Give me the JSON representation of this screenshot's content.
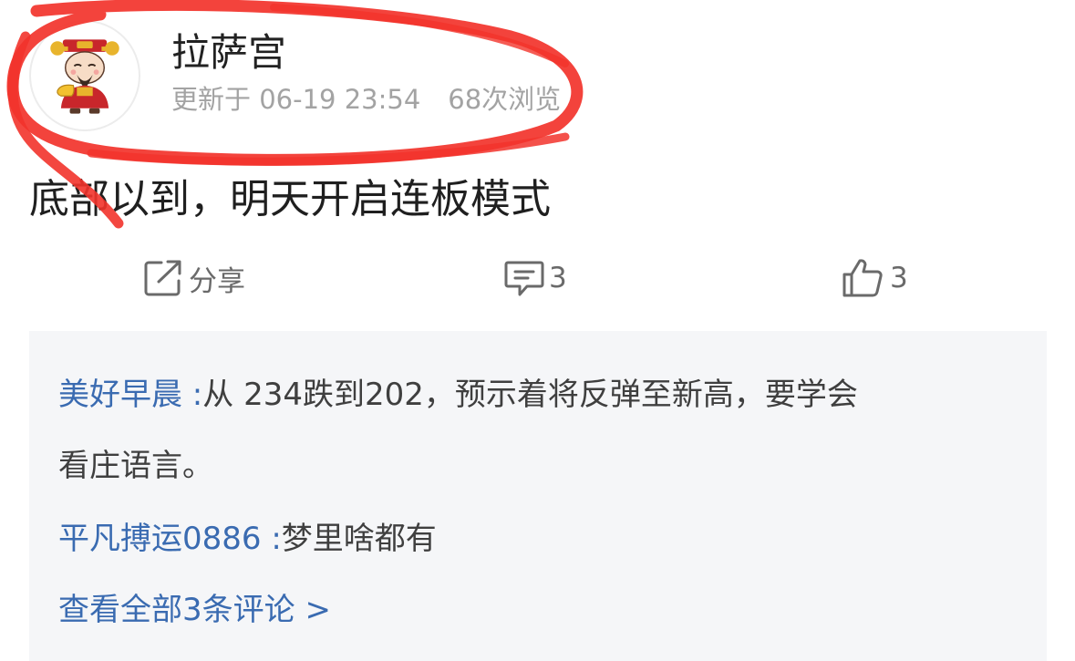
{
  "author": {
    "name": "拉萨宫",
    "avatar_icon": "god-of-wealth-avatar-icon"
  },
  "meta": {
    "updated": "更新于 06-19 23:54",
    "views": "68次浏览"
  },
  "post": {
    "text": "底部以到，明天开启连板模式"
  },
  "actions": {
    "share_label": "分享",
    "share_icon": "share-icon",
    "comment_count": "3",
    "comment_icon": "comment-icon",
    "like_count": "3",
    "like_icon": "thumbs-up-icon"
  },
  "comments": [
    {
      "author": "美好早晨",
      "separator": " :",
      "text_line1": "从 234跌到202，预示着将反弹至新高，要学会",
      "text_line2": "看庄语言。"
    },
    {
      "author": "平凡搏运0886",
      "separator": " :",
      "text_line1": "梦里啥都有"
    }
  ],
  "view_all_comments": "查看全部3条评论 >",
  "colors": {
    "link_blue": "#3a6bb1",
    "meta_gray": "#a3a3a3",
    "panel_bg": "#f5f6f8",
    "annotation_red": "#f2332b"
  }
}
